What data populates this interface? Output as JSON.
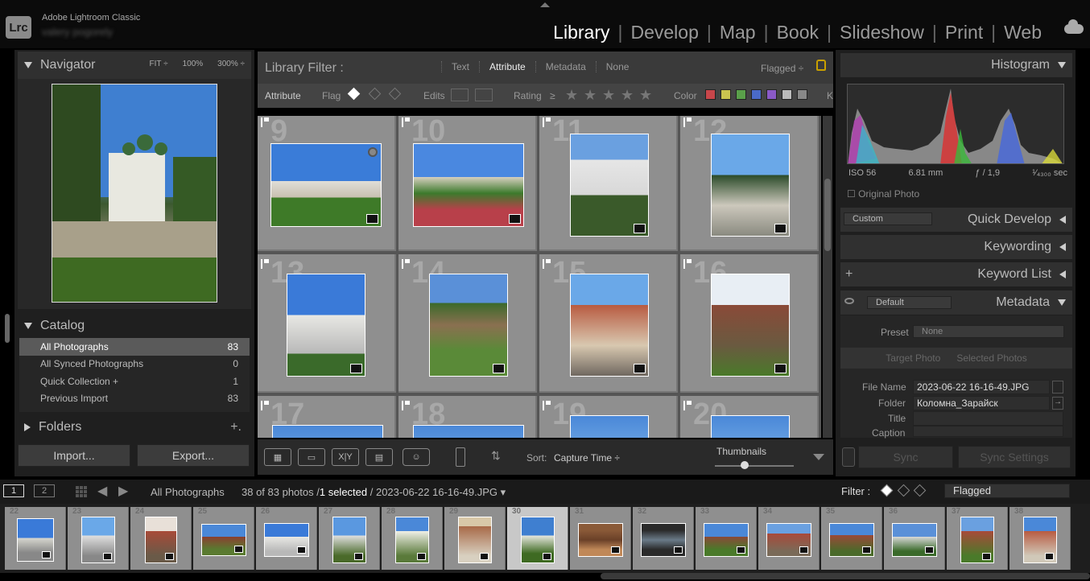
{
  "app": {
    "title": "Adobe Lightroom Classic",
    "logo": "Lrc",
    "user": "valery pogorely"
  },
  "modules": [
    "Library",
    "Develop",
    "Map",
    "Book",
    "Slideshow",
    "Print",
    "Web"
  ],
  "active_module": "Library",
  "navigator": {
    "title": "Navigator",
    "zoom": [
      "FIT ÷",
      "100%",
      "300% ÷"
    ]
  },
  "catalog": {
    "title": "Catalog",
    "items": [
      {
        "label": "All Photographs",
        "count": "83"
      },
      {
        "label": "All Synced Photographs",
        "count": "0"
      },
      {
        "label": "Quick Collection +",
        "count": "1"
      },
      {
        "label": "Previous Import",
        "count": "83"
      }
    ]
  },
  "folders": {
    "title": "Folders",
    "add": "+."
  },
  "buttons": {
    "import": "Import...",
    "export": "Export...",
    "sync": "Sync",
    "sync_settings": "Sync Settings"
  },
  "library_filter": {
    "title": "Library Filter :",
    "tabs": [
      "Text",
      "Attribute",
      "Metadata",
      "None"
    ],
    "active_tab": "Attribute",
    "preset": "Flagged ÷"
  },
  "attribute_bar": {
    "attribute": "Attribute",
    "flag": "Flag",
    "edits": "Edits",
    "rating": "Rating",
    "rating_op": "≥",
    "color": "Color",
    "kind": "K",
    "colors": [
      "#c8464a",
      "#c9c34f",
      "#5aa04a",
      "#4a6ac8",
      "#8a5ac8",
      "#bbbbbb",
      "#888888"
    ]
  },
  "grid": {
    "cells": [
      {
        "num": "9",
        "badge": true,
        "circle": true
      },
      {
        "num": "10",
        "badge": true
      },
      {
        "num": "11",
        "badge": true
      },
      {
        "num": "12",
        "badge": true
      },
      {
        "num": "13",
        "badge": true
      },
      {
        "num": "14",
        "badge": true
      },
      {
        "num": "15",
        "badge": true
      },
      {
        "num": "16",
        "badge": true
      },
      {
        "num": "17"
      },
      {
        "num": "18"
      },
      {
        "num": "19"
      },
      {
        "num": "20"
      }
    ]
  },
  "toolbar": {
    "sort_label": "Sort:",
    "sort_value": "Capture Time ÷",
    "thumbnails": "Thumbnails"
  },
  "right_panel": {
    "histogram": "Histogram",
    "iso": "ISO 56",
    "focal": "6.81 mm",
    "aperture": "ƒ / 1,9",
    "shutter": "¹⁄₄₃₀₀ sec",
    "original_photo": "Original Photo",
    "quick_develop": "Quick Develop",
    "qd_preset": "Custom",
    "keywording": "Keywording",
    "keyword_list": "Keyword List",
    "metadata": "Metadata",
    "metadata_preset": "Default",
    "preset_label": "Preset",
    "preset_value": "None",
    "target_photo": "Target Photo",
    "selected_photos": "Selected Photos",
    "fields": [
      {
        "label": "File Name",
        "value": "2023-06-22 16-16-49.JPG"
      },
      {
        "label": "Folder",
        "value": "Коломна_Зарайск"
      },
      {
        "label": "Title",
        "value": ""
      },
      {
        "label": "Caption",
        "value": ""
      }
    ]
  },
  "filmstrip": {
    "screen1": "1",
    "screen2": "2",
    "source": "All Photographs",
    "count": "38 of 83 photos /",
    "selected": "1 selected",
    "file": "/ 2023-06-22 16-16-49.JPG ▾",
    "filter_label": "Filter :",
    "filter_value": "Flagged",
    "thumbs": [
      "22",
      "23",
      "24",
      "25",
      "26",
      "27",
      "28",
      "29",
      "30",
      "31",
      "32",
      "33",
      "34",
      "35",
      "36",
      "37",
      "38"
    ],
    "selected_index": 8
  }
}
